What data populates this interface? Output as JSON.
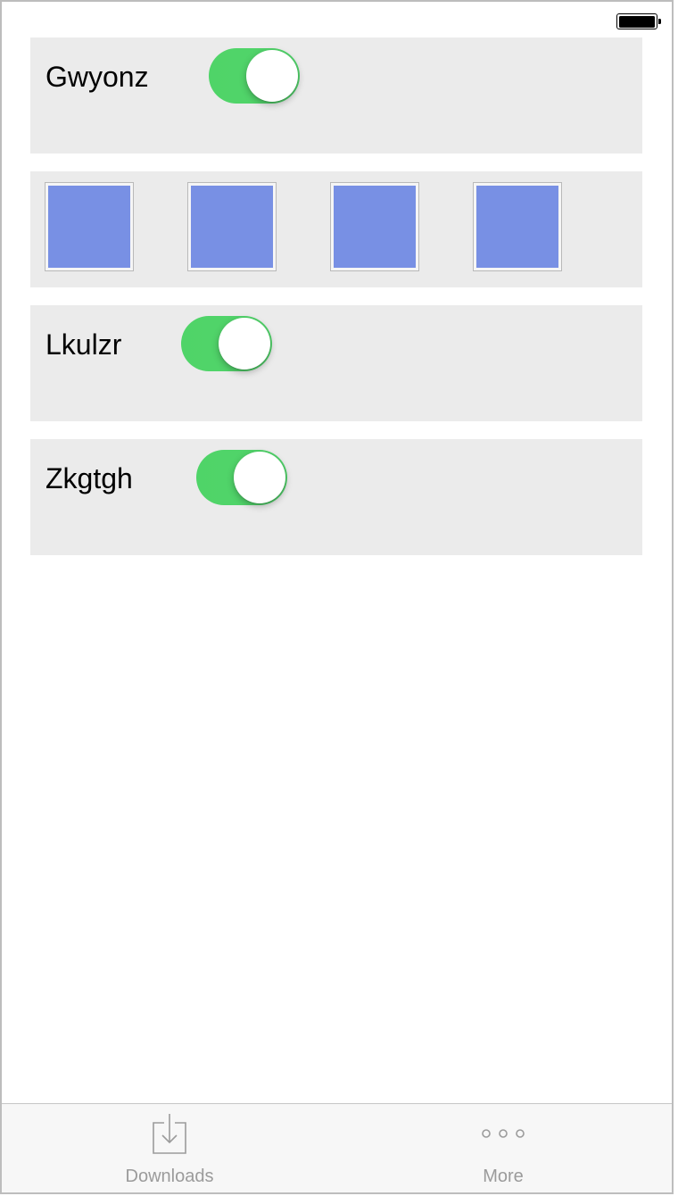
{
  "status_bar": {
    "battery_level": 1.0,
    "icon": "battery-icon"
  },
  "rows": [
    {
      "label": "Gwyonz",
      "toggle_on": true
    },
    {
      "tiles": [
        {
          "color": "#7890e4"
        },
        {
          "color": "#7890e4"
        },
        {
          "color": "#7890e4"
        },
        {
          "color": "#7890e4"
        }
      ]
    },
    {
      "label": "Lkulzr",
      "toggle_on": true
    },
    {
      "label": "Zkgtgh",
      "toggle_on": true
    }
  ],
  "colors": {
    "toggle_on": "#4fd468",
    "panel_bg": "#ebebeb",
    "tile_fill": "#7890e4",
    "tab_text": "#9b9b9b"
  },
  "tab_bar": {
    "items": [
      {
        "label": "Downloads",
        "icon": "downloads-icon"
      },
      {
        "label": "More",
        "icon": "more-icon"
      }
    ]
  }
}
